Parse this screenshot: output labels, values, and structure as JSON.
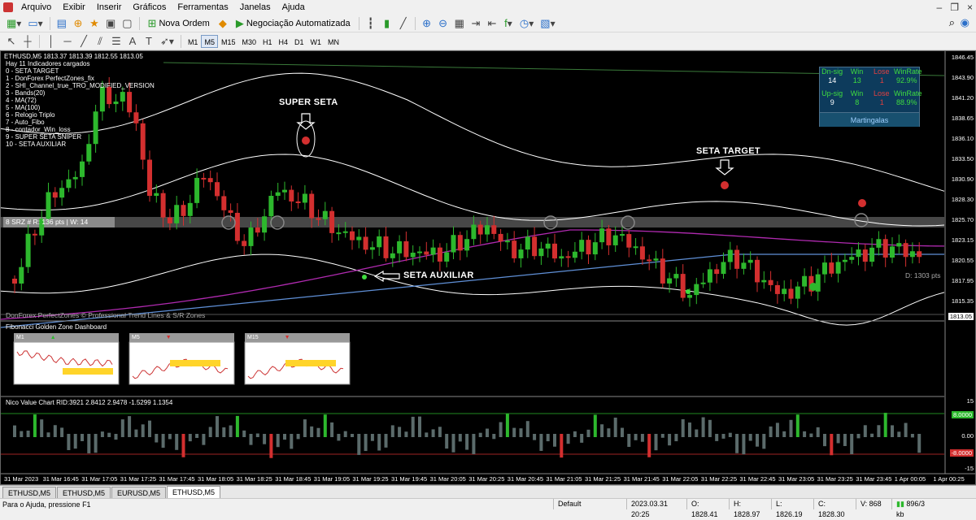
{
  "menu": [
    "Arquivo",
    "Exibir",
    "Inserir",
    "Gráficos",
    "Ferramentas",
    "Janelas",
    "Ajuda"
  ],
  "toolbar": {
    "new_order": "Nova Ordem",
    "auto_trading": "Negociação Automatizada"
  },
  "timeframes": [
    "M1",
    "M5",
    "M15",
    "M30",
    "H1",
    "H4",
    "D1",
    "W1",
    "MN"
  ],
  "chart": {
    "header": "ETHUSD,M5  1813.37 1813.39 1812.55 1813.05",
    "indicators_title": "Hay 11 Indicadores cargados",
    "indicators": [
      "0 - SETA TARGET",
      "1 - DonForex PerfectZones_fix",
      "2 - SHI_Channel_true_TRO_MODIFIED_VERSION",
      "3 - Bands(20)",
      "4 - MA(72)",
      "5 - MA(100)",
      "6 - Relogio Triplo",
      "7 - Auto_Fibo",
      "8 - contador_Win_loss",
      "9 - SUPER SETA SNIPER",
      "10 - SETA AUXILIAR"
    ],
    "annotations": {
      "super_seta": "SUPER SETA",
      "seta_target": "SETA TARGET",
      "seta_auxiliar": "SETA AUXILIAR"
    },
    "zone_label": "8  SRZ # R: 136 pts  |  W: 14",
    "watermark": "DonForex PerfectZones © Professional Trend Lines & S/R Zones",
    "distance_label": "D: 1303 pts",
    "current_price": "1813.05",
    "price_axis": [
      "1846.45",
      "1843.90",
      "1841.20",
      "1838.65",
      "1836.10",
      "1833.50",
      "1830.90",
      "1828.30",
      "1825.70",
      "1823.15",
      "1820.55",
      "1817.95",
      "1815.35"
    ]
  },
  "dashboard": {
    "rows": [
      {
        "label": "Dn-sig",
        "win_label": "Win",
        "lose_label": "Lose",
        "rate_label": "WinRate",
        "count": "14",
        "win": "13",
        "lose": "1",
        "rate": "92.9%"
      },
      {
        "label": "Up-sig",
        "win_label": "Win",
        "lose_label": "Lose",
        "rate_label": "WinRate",
        "count": "9",
        "win": "8",
        "lose": "1",
        "rate": "88.9%"
      }
    ],
    "footer": "Martingalas"
  },
  "fib_panel": {
    "title": "Fibonacci Golden Zone Dashboard",
    "tiles": [
      {
        "tf": "M1",
        "dir": "up"
      },
      {
        "tf": "M5",
        "dir": "down"
      },
      {
        "tf": "M15",
        "dir": "down"
      }
    ]
  },
  "value_chart": {
    "title": "Nico Value Chart RID:3921 2.8412 2.9478 -1.5299 1.1354",
    "axis": [
      "15",
      "0.00",
      "-15"
    ],
    "upper_tag": "8.0000",
    "lower_tag": "-8.0000"
  },
  "time_axis": [
    "31 Mar 2023",
    "31 Mar 16:45",
    "31 Mar 17:05",
    "31 Mar 17:25",
    "31 Mar 17:45",
    "31 Mar 18:05",
    "31 Mar 18:25",
    "31 Mar 18:45",
    "31 Mar 19:05",
    "31 Mar 19:25",
    "31 Mar 19:45",
    "31 Mar 20:05",
    "31 Mar 20:25",
    "31 Mar 20:45",
    "31 Mar 21:05",
    "31 Mar 21:25",
    "31 Mar 21:45",
    "31 Mar 22:05",
    "31 Mar 22:25",
    "31 Mar 22:45",
    "31 Mar 23:05",
    "31 Mar 23:25",
    "31 Mar 23:45",
    "1 Apr 00:05",
    "1 Apr 00:25"
  ],
  "tabs": [
    "ETHUSD,M5",
    "ETHUSD,M5",
    "EURUSD,M5",
    "ETHUSD,M5"
  ],
  "status": {
    "help": "Para o Ajuda, pressione F1",
    "profile": "Default",
    "datetime": "2023.03.31 20:25",
    "open": "O: 1828.41",
    "high": "H: 1828.97",
    "low": "L: 1826.19",
    "close": "C: 1828.30",
    "volume": "V: 868",
    "traffic": "896/3 kb"
  },
  "colors": {
    "bull": "#2db82d",
    "bear": "#d32f2f",
    "ma72": "#b02ab0",
    "ma100": "#5f8fd6",
    "band": "#ffffff",
    "zone": "#4a4a4a"
  }
}
